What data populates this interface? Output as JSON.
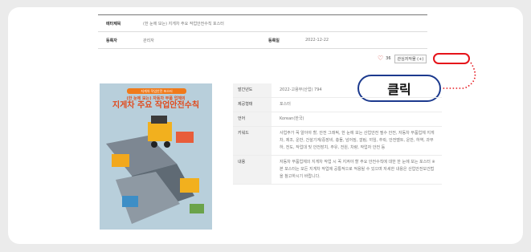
{
  "meta": {
    "row1_label": "메타제목",
    "row1_value": "(한 눈에 보는) 지게차 주요 작업안전수칙 포스터",
    "row2_label": "등록자",
    "row2_value": "관리자",
    "row2_label2": "등록일",
    "row2_value2": "2022-12-22"
  },
  "favorite": {
    "count": "36",
    "button_label": "관심저작물 (+)"
  },
  "callout": {
    "label": "클릭",
    "highlight_color": "#e5131a",
    "bubble_border_color": "#1c3a8e"
  },
  "poster": {
    "banner": "지게차 작업안전 포스터",
    "subtitle": "(한 눈에 보는) 자동차 부품 업체의",
    "title": "지게차 주요 작업안전수칙"
  },
  "info": [
    {
      "label": "발간년도",
      "value": "2022-고용부(산업) 794"
    },
    {
      "label": "제공형태",
      "value": "포스터"
    },
    {
      "label": "언어",
      "value": "Korean(한국)"
    },
    {
      "label": "키워드",
      "value": "사업주가 꼭 알아야 할, 안전 그래픽, 한 눈에 보는 산업안전 필수 안전, 자동차 부품업체 지게차, 제조, 운반, 건설기계/중장비, 충돌, 넘어짐, 깔림, 끼임, 추락, 안전벨트, 운반, 하역, 과부하, 전도, 작업대 및 안전장치, 주유, 전원, 차량, 작업자 안전 등"
    },
    {
      "label": "내용",
      "value": "자동차 부품업체의 지게차 작업 시 꼭 지켜야 할 주요 안전수칙에 대한 한 눈에 보는 포스터 \n※ 본 포스터는 모든 지게차 작업에 공통적으로 적용될 수 있으며 자세한 내용은 산업안전보건법을 참고하시기 바랍니다."
    }
  ]
}
